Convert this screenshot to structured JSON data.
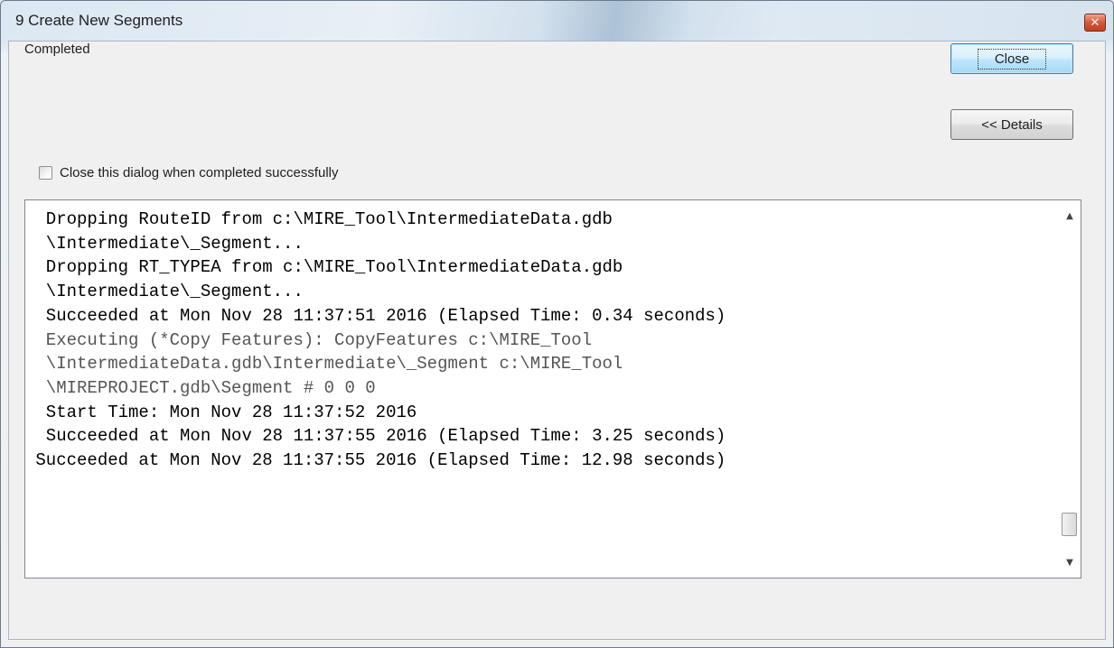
{
  "window": {
    "title": "9 Create New Segments",
    "close_glyph": "✕"
  },
  "status_text": "Completed",
  "buttons": {
    "close_label": "Close",
    "details_label": "<< Details"
  },
  "option": {
    "checkbox_label": "Close this dialog when completed successfully",
    "checked": false
  },
  "log": {
    "lines": [
      {
        "text": "  Dropping RouteID from c:\\MIRE_Tool\\IntermediateData.gdb",
        "style": "normal"
      },
      {
        "text": "  \\Intermediate\\_Segment...",
        "style": "normal"
      },
      {
        "text": "  Dropping RT_TYPEA from c:\\MIRE_Tool\\IntermediateData.gdb",
        "style": "normal"
      },
      {
        "text": "  \\Intermediate\\_Segment...",
        "style": "normal"
      },
      {
        "text": "  Succeeded at Mon Nov 28 11:37:51 2016 (Elapsed Time: 0.34 seconds)",
        "style": "normal"
      },
      {
        "text": "  Executing (*Copy Features): CopyFeatures c:\\MIRE_Tool",
        "style": "gray"
      },
      {
        "text": "  \\IntermediateData.gdb\\Intermediate\\_Segment c:\\MIRE_Tool",
        "style": "gray"
      },
      {
        "text": "  \\MIREPROJECT.gdb\\Segment # 0 0 0",
        "style": "gray"
      },
      {
        "text": "  Start Time: Mon Nov 28 11:37:52 2016",
        "style": "normal"
      },
      {
        "text": "  Succeeded at Mon Nov 28 11:37:55 2016 (Elapsed Time: 3.25 seconds)",
        "style": "normal"
      },
      {
        "text": " Succeeded at Mon Nov 28 11:37:55 2016 (Elapsed Time: 12.98 seconds)",
        "style": "normal"
      }
    ]
  },
  "scrollbar": {
    "up_glyph": "▲",
    "down_glyph": "▼"
  }
}
